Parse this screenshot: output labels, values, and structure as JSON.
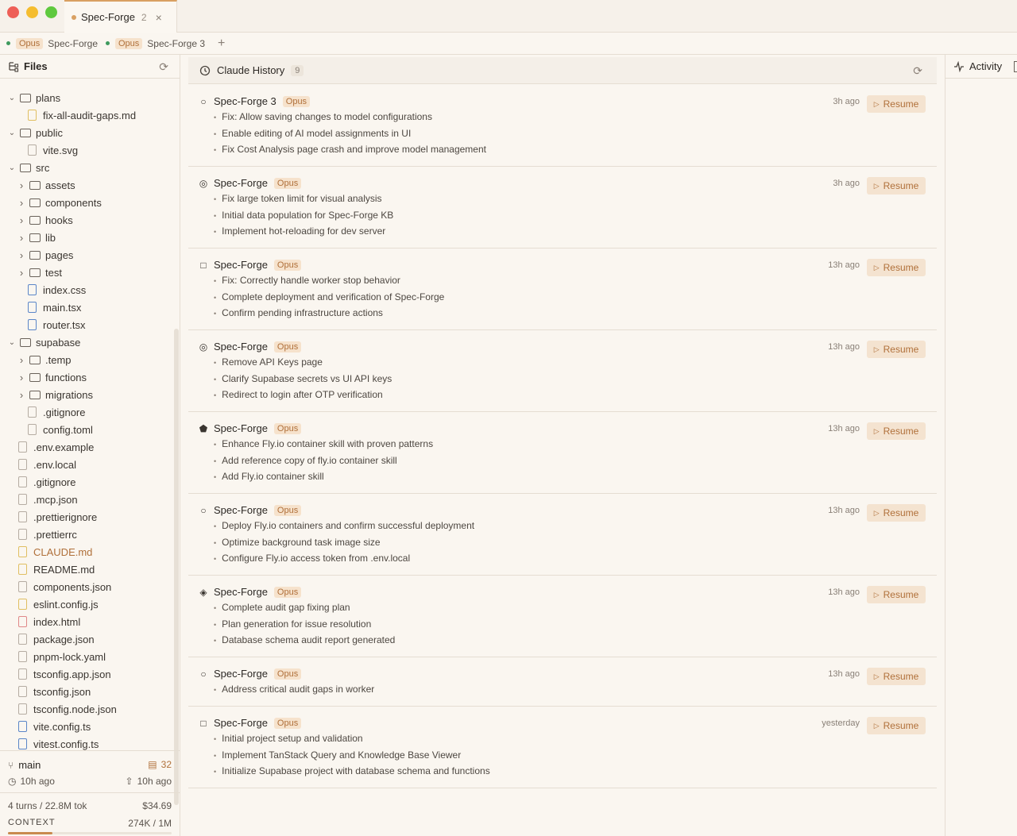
{
  "window": {
    "tab_title": "Spec-Forge",
    "tab_count": "2",
    "close_glyph": "×"
  },
  "sessions": [
    {
      "badge": "Opus",
      "name": "Spec-Forge"
    },
    {
      "badge": "Opus",
      "name": "Spec-Forge 3"
    }
  ],
  "session_add": "+",
  "sidebar": {
    "title": "Files",
    "tree": [
      {
        "label": "plans",
        "type": "folder",
        "open": true,
        "depth": 1
      },
      {
        "label": "fix-all-audit-gaps.md",
        "type": "file",
        "color": "yellow",
        "depth": 2
      },
      {
        "label": "public",
        "type": "folder",
        "open": true,
        "depth": 1
      },
      {
        "label": "vite.svg",
        "type": "file",
        "color": "gray",
        "depth": 2
      },
      {
        "label": "src",
        "type": "folder",
        "open": true,
        "depth": 1
      },
      {
        "label": "assets",
        "type": "folder",
        "open": false,
        "depth": 2
      },
      {
        "label": "components",
        "type": "folder",
        "open": false,
        "depth": 2
      },
      {
        "label": "hooks",
        "type": "folder",
        "open": false,
        "depth": 2
      },
      {
        "label": "lib",
        "type": "folder",
        "open": false,
        "depth": 2
      },
      {
        "label": "pages",
        "type": "folder",
        "open": false,
        "depth": 2
      },
      {
        "label": "test",
        "type": "folder",
        "open": false,
        "depth": 2
      },
      {
        "label": "index.css",
        "type": "file",
        "color": "blue",
        "depth": 2
      },
      {
        "label": "main.tsx",
        "type": "file",
        "color": "blue",
        "depth": 2
      },
      {
        "label": "router.tsx",
        "type": "file",
        "color": "blue",
        "depth": 2
      },
      {
        "label": "supabase",
        "type": "folder",
        "open": true,
        "depth": 1
      },
      {
        "label": ".temp",
        "type": "folder",
        "open": false,
        "depth": 2
      },
      {
        "label": "functions",
        "type": "folder",
        "open": false,
        "depth": 2
      },
      {
        "label": "migrations",
        "type": "folder",
        "open": false,
        "depth": 2
      },
      {
        "label": ".gitignore",
        "type": "file",
        "color": "gray",
        "depth": 2
      },
      {
        "label": "config.toml",
        "type": "file",
        "color": "gray",
        "depth": 2
      },
      {
        "label": ".env.example",
        "type": "file",
        "color": "gray",
        "depth": 0
      },
      {
        "label": ".env.local",
        "type": "file",
        "color": "gray",
        "depth": 0
      },
      {
        "label": ".gitignore",
        "type": "file",
        "color": "gray",
        "depth": 0
      },
      {
        "label": ".mcp.json",
        "type": "file",
        "color": "gray",
        "depth": 0
      },
      {
        "label": ".prettierignore",
        "type": "file",
        "color": "gray",
        "depth": 0
      },
      {
        "label": ".prettierrc",
        "type": "file",
        "color": "gray",
        "depth": 0
      },
      {
        "label": "CLAUDE.md",
        "type": "file",
        "color": "yellow",
        "highlight": true,
        "depth": 0
      },
      {
        "label": "README.md",
        "type": "file",
        "color": "yellow",
        "depth": 0
      },
      {
        "label": "components.json",
        "type": "file",
        "color": "gray",
        "depth": 0
      },
      {
        "label": "eslint.config.js",
        "type": "file",
        "color": "yellow",
        "depth": 0
      },
      {
        "label": "index.html",
        "type": "file",
        "color": "red",
        "depth": 0
      },
      {
        "label": "package.json",
        "type": "file",
        "color": "gray",
        "depth": 0
      },
      {
        "label": "pnpm-lock.yaml",
        "type": "file",
        "color": "gray",
        "depth": 0
      },
      {
        "label": "tsconfig.app.json",
        "type": "file",
        "color": "gray",
        "depth": 0
      },
      {
        "label": "tsconfig.json",
        "type": "file",
        "color": "gray",
        "depth": 0
      },
      {
        "label": "tsconfig.node.json",
        "type": "file",
        "color": "gray",
        "depth": 0
      },
      {
        "label": "vite.config.ts",
        "type": "file",
        "color": "blue",
        "depth": 0
      },
      {
        "label": "vitest.config.ts",
        "type": "file",
        "color": "blue",
        "depth": 0
      }
    ],
    "footer": {
      "branch": "main",
      "changes": "32",
      "last_commit": "10h ago",
      "last_push": "10h ago",
      "turns": "4 turns / 22.8M tok",
      "cost": "$34.69",
      "context_label": "CONTEXT",
      "context_value": "274K / 1M",
      "context_fraction": 0.274
    }
  },
  "main": {
    "title": "Claude History",
    "count": "9",
    "resume_label": "Resume",
    "cards": [
      {
        "symbol": "○",
        "name": "Spec-Forge 3",
        "badge": "Opus",
        "time": "3h ago",
        "items": [
          "Fix: Allow saving changes to model configurations",
          "Enable editing of AI model assignments in UI",
          "Fix Cost Analysis page crash and improve model management"
        ]
      },
      {
        "symbol": "◎",
        "name": "Spec-Forge",
        "badge": "Opus",
        "time": "3h ago",
        "items": [
          "Fix large token limit for visual analysis",
          "Initial data population for Spec-Forge KB",
          "Implement hot-reloading for dev server"
        ]
      },
      {
        "symbol": "□",
        "name": "Spec-Forge",
        "badge": "Opus",
        "time": "13h ago",
        "items": [
          "Fix: Correctly handle worker stop behavior",
          "Complete deployment and verification of Spec-Forge",
          "Confirm pending infrastructure actions"
        ]
      },
      {
        "symbol": "◎",
        "name": "Spec-Forge",
        "badge": "Opus",
        "time": "13h ago",
        "items": [
          "Remove API Keys page",
          "Clarify Supabase secrets vs UI API keys",
          "Redirect to login after OTP verification"
        ]
      },
      {
        "symbol": "⬟",
        "name": "Spec-Forge",
        "badge": "Opus",
        "time": "13h ago",
        "items": [
          "Enhance Fly.io container skill with proven patterns",
          "Add reference copy of fly.io container skill",
          "Add Fly.io container skill"
        ]
      },
      {
        "symbol": "○",
        "name": "Spec-Forge",
        "badge": "Opus",
        "time": "13h ago",
        "items": [
          "Deploy Fly.io containers and confirm successful deployment",
          "Optimize background task image size",
          "Configure Fly.io access token from .env.local"
        ]
      },
      {
        "symbol": "◈",
        "name": "Spec-Forge",
        "badge": "Opus",
        "time": "13h ago",
        "items": [
          "Complete audit gap fixing plan",
          "Plan generation for issue resolution",
          "Database schema audit report generated"
        ]
      },
      {
        "symbol": "○",
        "name": "Spec-Forge",
        "badge": "Opus",
        "time": "13h ago",
        "items": [
          "Address critical audit gaps in worker"
        ]
      },
      {
        "symbol": "□",
        "name": "Spec-Forge",
        "badge": "Opus",
        "time": "yesterday",
        "items": [
          "Initial project setup and validation",
          "Implement TanStack Query and Knowledge Base Viewer",
          "Initialize Supabase project with database schema and functions"
        ]
      }
    ]
  },
  "rpanel": {
    "title": "Activity"
  }
}
